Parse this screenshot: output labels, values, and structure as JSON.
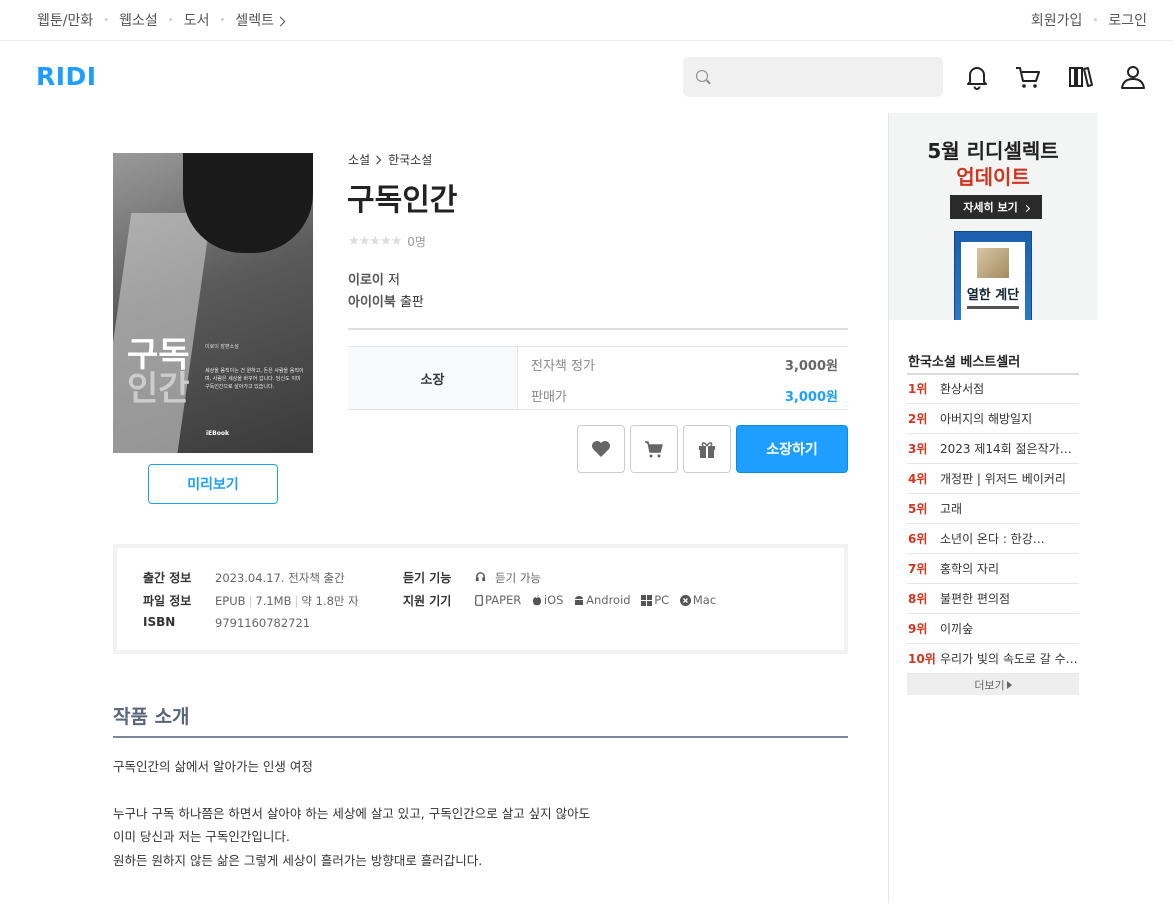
{
  "topnav": {
    "items": [
      {
        "label": "웹툰/만화"
      },
      {
        "label": "웹소설"
      },
      {
        "label": "도서"
      },
      {
        "label": "셀렉트"
      }
    ],
    "signup": "회원가입",
    "login": "로그인"
  },
  "header": {
    "logo": "RIDI",
    "search_placeholder": "",
    "icons": [
      "bell-icon",
      "cart-icon",
      "library-icon",
      "user-icon"
    ]
  },
  "book": {
    "breadcrumb": [
      "소설",
      "한국소설"
    ],
    "title": "구독인간",
    "rating_count": "0명",
    "author_name": "이로이",
    "author_suffix": " 저",
    "publisher_name": "아이이북",
    "publisher_suffix": " 출판",
    "cover": {
      "title_line1": "구독",
      "title_line2": "인간",
      "author": "이로이 장편소설",
      "blurb": "세상을 움직이는 건 원하고, 돈은 사람을 움직이며, 사람은 세상을 바꾸어 갑니다. 당신도 이미 구독인간으로 살아가고 있습니다.",
      "publisher": "iEBook"
    },
    "preview_button": "미리보기",
    "price": {
      "type_label": "소장",
      "list_label": "전자책 정가",
      "list_value": "3,000원",
      "sale_label": "판매가",
      "sale_value": "3,000원"
    },
    "buy_button": "소장하기"
  },
  "meta": {
    "publish_key": "출간 정보",
    "publish_value": "2023.04.17. 전자책 출간",
    "file_key": "파일 정보",
    "file_format": "EPUB",
    "file_size": "7.1MB",
    "file_chars": "약 1.8만 자",
    "isbn_key": "ISBN",
    "isbn_value": "9791160782721",
    "listen_key": "듣기 기능",
    "listen_value": "듣기 가능",
    "devices_key": "지원 기기",
    "devices": [
      "PAPER",
      "iOS",
      "Android",
      "PC",
      "Mac"
    ]
  },
  "intro": {
    "title": "작품 소개",
    "lines": [
      "구독인간의 삶에서 알아가는 인생 여정",
      "누구나 구독 하나쯤은 하면서 살아야 하는 세상에 살고 있고, 구독인간으로 살고 싶지 않아도",
      "이미 당신과 저는 구독인간입니다.",
      "원하든 원하지 않든 삶은 그렇게 세상이 흘러가는 방향대로 흘러갑니다."
    ]
  },
  "sidebar": {
    "ad": {
      "line1": "5월 리디셀렉트",
      "line2": "업데이트",
      "button": "자세히 보기",
      "book_title": "열한 계단"
    },
    "bestseller_title": "한국소설 베스트셀러",
    "bestsellers": [
      {
        "rank": "1위",
        "title": "환상서점"
      },
      {
        "rank": "2위",
        "title": "아버지의 해방일지"
      },
      {
        "rank": "3위",
        "title": "2023 제14회 젊은작가상…"
      },
      {
        "rank": "4위",
        "title": "개정판 | 위저드 베이커리"
      },
      {
        "rank": "5위",
        "title": "고래"
      },
      {
        "rank": "6위",
        "title": "소년이 온다 : 한강…"
      },
      {
        "rank": "7위",
        "title": "홍학의 자리"
      },
      {
        "rank": "8위",
        "title": "불편한 편의점"
      },
      {
        "rank": "9위",
        "title": "이끼숲"
      },
      {
        "rank": "10위",
        "title": "우리가 빛의 속도로 갈 수…"
      }
    ],
    "more": "더보기"
  },
  "colors": {
    "brand": "#1e9eff",
    "rank": "#d0351f",
    "ad_accent": "#d0351f"
  }
}
